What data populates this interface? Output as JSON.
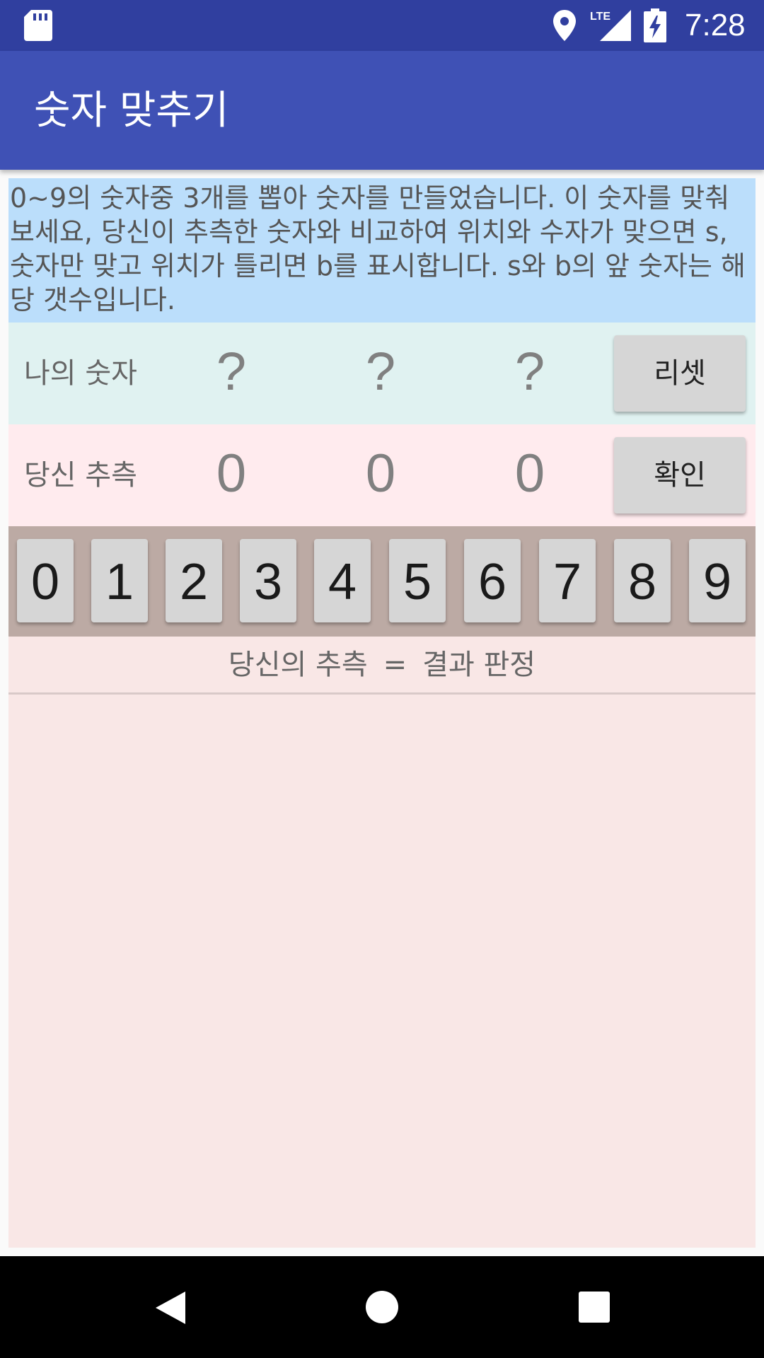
{
  "status_bar": {
    "time": "7:28",
    "icons": [
      "sd-card-icon",
      "location-icon",
      "lte-signal-icon",
      "battery-charging-icon"
    ]
  },
  "app_bar": {
    "title": "숫자 맞추기"
  },
  "instructions": "0~9의 숫자중 3개를 뽑아 숫자를 만들었습니다. 이 숫자를 맞춰 보세요, 당신이 추측한 숫자와 비교하여 위치와 수자가 맞으면 s, 숫자만 맞고 위치가 틀리면 b를 표시합니다. s와 b의 앞 숫자는 해당 갯수입니다.",
  "my_number": {
    "label": "나의 숫자",
    "digits": [
      "?",
      "?",
      "?"
    ],
    "button_label": "리셋"
  },
  "guess": {
    "label": "당신 추측",
    "digits": [
      "0",
      "0",
      "0"
    ],
    "button_label": "확인"
  },
  "keypad": {
    "keys": [
      "0",
      "1",
      "2",
      "3",
      "4",
      "5",
      "6",
      "7",
      "8",
      "9"
    ]
  },
  "result_header": {
    "left": "당신의 추측",
    "separator": "=",
    "right": "결과 판정"
  },
  "nav_bar": {
    "icons": [
      "back-icon",
      "home-icon",
      "recent-apps-icon"
    ]
  },
  "colors": {
    "status_bar": "#303f9f",
    "app_bar": "#3f51b5",
    "instructions_bg": "#bbdefb",
    "my_number_bg": "#e0f2f1",
    "guess_bg": "#ffebee",
    "keypad_bg": "#bcaaa4",
    "content_bg": "#f9e7e6"
  }
}
